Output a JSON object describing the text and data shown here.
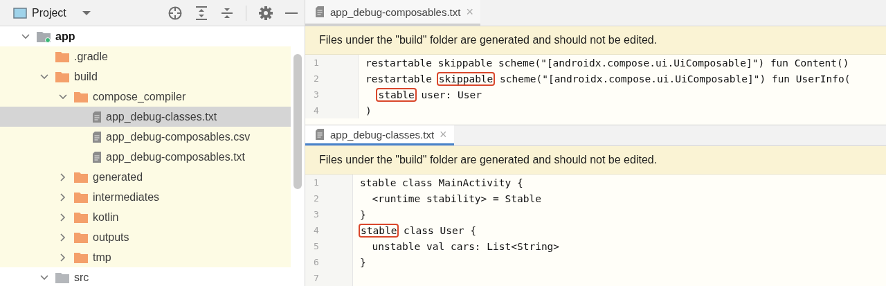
{
  "project_panel": {
    "title": "Project",
    "tree": [
      {
        "label": "app",
        "kind": "module",
        "expanded": true,
        "selected": false,
        "generated": false,
        "children": [
          {
            "label": ".gradle",
            "kind": "folder",
            "selected": false,
            "generated": true
          },
          {
            "label": "build",
            "kind": "folder",
            "expanded": true,
            "selected": false,
            "generated": true,
            "children": [
              {
                "label": "compose_compiler",
                "kind": "folder",
                "expanded": true,
                "selected": false,
                "generated": true,
                "children": [
                  {
                    "label": "app_debug-classes.txt",
                    "kind": "file",
                    "selected": true,
                    "generated": true
                  },
                  {
                    "label": "app_debug-composables.csv",
                    "kind": "file",
                    "selected": false,
                    "generated": true
                  },
                  {
                    "label": "app_debug-composables.txt",
                    "kind": "file",
                    "selected": false,
                    "generated": true
                  }
                ]
              },
              {
                "label": "generated",
                "kind": "folder",
                "expanded": false,
                "selected": false,
                "generated": true
              },
              {
                "label": "intermediates",
                "kind": "folder",
                "expanded": false,
                "selected": false,
                "generated": true
              },
              {
                "label": "kotlin",
                "kind": "folder",
                "expanded": false,
                "selected": false,
                "generated": true
              },
              {
                "label": "outputs",
                "kind": "folder",
                "expanded": false,
                "selected": false,
                "generated": true
              },
              {
                "label": "tmp",
                "kind": "folder",
                "expanded": false,
                "selected": false,
                "generated": true
              }
            ]
          },
          {
            "label": "src",
            "kind": "source",
            "expanded": true,
            "selected": false,
            "generated": false
          }
        ]
      }
    ]
  },
  "editors": [
    {
      "tab": {
        "label": "app_debug-composables.txt",
        "close": "×"
      },
      "active": false,
      "banner": "Files under the \"build\" folder are generated and should not be edited.",
      "lines": [
        {
          "number": "1",
          "indented": false,
          "segments": [
            {
              "text": "restartable skippable scheme(\"[androidx.compose.ui.UiComposable]\") fun Content()",
              "boxed": false
            }
          ]
        },
        {
          "number": "2",
          "indented": false,
          "segments": [
            {
              "text": "restartable ",
              "boxed": false
            },
            {
              "text": "skippable",
              "boxed": true
            },
            {
              "text": " scheme(\"[androidx.compose.ui.UiComposable]\") fun UserInfo(",
              "boxed": false
            }
          ]
        },
        {
          "number": "3",
          "indented": true,
          "segments": [
            {
              "text": "stable",
              "boxed": true
            },
            {
              "text": " user: User",
              "boxed": false
            }
          ]
        },
        {
          "number": "4",
          "indented": false,
          "segments": [
            {
              "text": ")",
              "boxed": false
            }
          ]
        }
      ]
    },
    {
      "tab": {
        "label": "app_debug-classes.txt",
        "close": "×"
      },
      "active": true,
      "banner": "Files under the \"build\" folder are generated and should not be edited.",
      "lines": [
        {
          "number": "1",
          "indented": false,
          "segments": [
            {
              "text": "stable class MainActivity {",
              "boxed": false
            }
          ]
        },
        {
          "number": "2",
          "indented": true,
          "segments": [
            {
              "text": "<runtime stability> = Stable",
              "boxed": false
            }
          ]
        },
        {
          "number": "3",
          "indented": false,
          "segments": [
            {
              "text": "}",
              "boxed": false
            }
          ]
        },
        {
          "number": "4",
          "indented": false,
          "segments": [
            {
              "text": "stable",
              "boxed": true
            },
            {
              "text": " class User {",
              "boxed": false
            }
          ]
        },
        {
          "number": "5",
          "indented": true,
          "segments": [
            {
              "text": "unstable val cars: List<String>",
              "boxed": false
            }
          ]
        },
        {
          "number": "6",
          "indented": false,
          "segments": [
            {
              "text": "}",
              "boxed": false
            }
          ]
        },
        {
          "number": "7"
        }
      ]
    }
  ]
}
